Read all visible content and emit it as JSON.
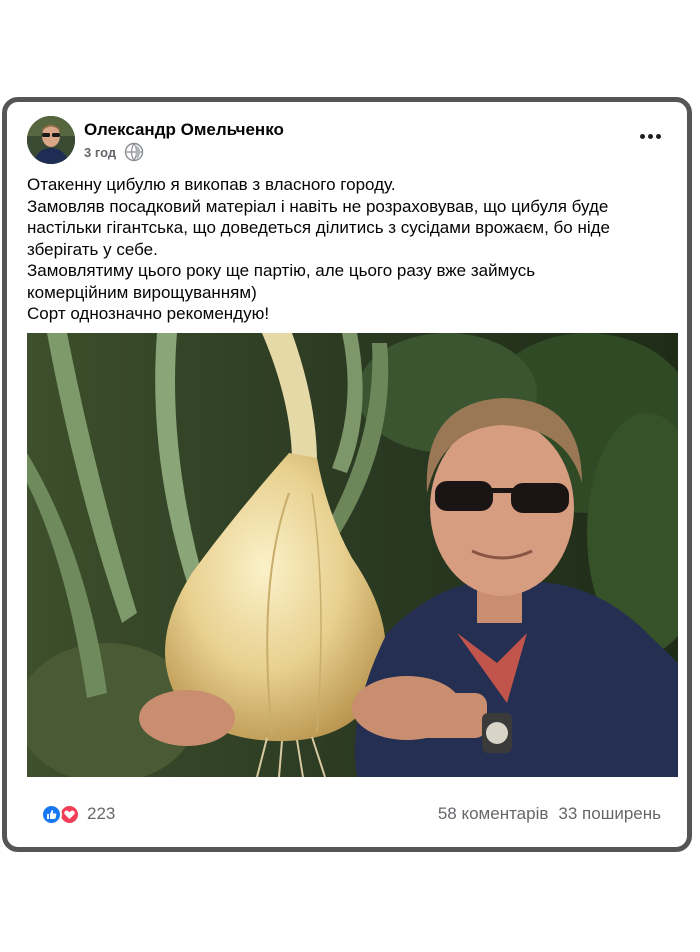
{
  "post": {
    "author_name": "Олександр Омельченко",
    "time": "3 год",
    "privacy_icon": "globe-icon",
    "menu_icon": "more-horizontal-icon",
    "text_lines": [
      "Отакенну цибулю я викопав з власного городу.",
      "Замовляв посадковий матеріал і навіть не розраховував, що цибуля буде",
      "настільки гігантська, що доведеться ділитись з сусідами врожаєм, бо ніде",
      "зберігать у себе.",
      "Замовлятиму цього року ще партію, але цього разу вже займусь",
      "комерційним вирощуванням)",
      "Сорт однозначно рекомендую!"
    ],
    "photo": "man-holding-giant-onion-photo"
  },
  "footer": {
    "reaction_icons": [
      "like-icon",
      "love-icon"
    ],
    "reaction_count": "223",
    "comments": "58 коментарів",
    "shares": "33 поширень"
  },
  "colors": {
    "card_border": "#555555",
    "text_primary": "#050505",
    "text_secondary": "#65676b",
    "like_blue": "#1877f2",
    "love_red": "#f33e58"
  }
}
